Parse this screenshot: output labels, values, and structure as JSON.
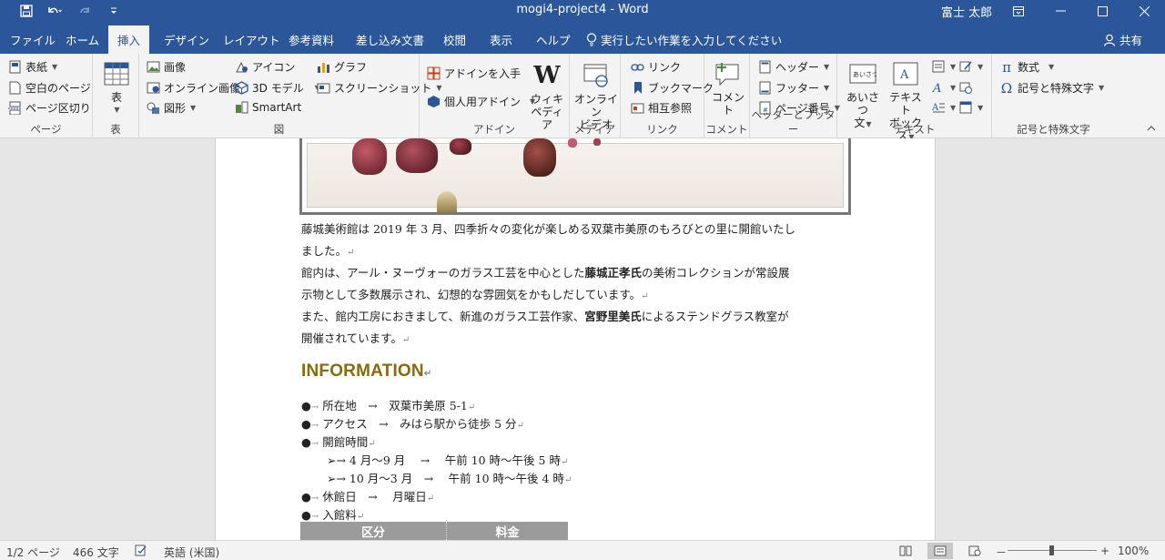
{
  "titlebar": {
    "document_title": "mogi4-project4  -  Word",
    "user_name": "富士 太郎"
  },
  "tabs": [
    {
      "label": "ファイル"
    },
    {
      "label": "ホーム"
    },
    {
      "label": "挿入"
    },
    {
      "label": "デザイン"
    },
    {
      "label": "レイアウト"
    },
    {
      "label": "参考資料"
    },
    {
      "label": "差し込み文書"
    },
    {
      "label": "校閲"
    },
    {
      "label": "表示"
    },
    {
      "label": "ヘルプ"
    }
  ],
  "tell_me": "実行したい作業を入力してください",
  "share": "共有",
  "ribbon": {
    "page_group": {
      "label": "ページ",
      "cover": "表紙",
      "blank": "空白のページ",
      "break": "ページ区切り"
    },
    "table_group": {
      "label": "表",
      "table": "表"
    },
    "illust_group": {
      "label": "図",
      "picture": "画像",
      "online_picture": "オンライン画像",
      "shapes": "図形",
      "icons": "アイコン",
      "models3d": "3D モデル",
      "smartart": "SmartArt",
      "chart": "グラフ",
      "screenshot": "スクリーンショット"
    },
    "addin_group": {
      "label": "アドイン",
      "get": "アドインを入手",
      "my": "個人用アドイン",
      "wiki1": "ウィキ",
      "wiki2": "ペディア"
    },
    "media_group": {
      "label": "メディア",
      "video1": "オンライン",
      "video2": "ビデオ"
    },
    "link_group": {
      "label": "リンク",
      "link": "リンク",
      "bookmark": "ブックマーク",
      "crossref": "相互参照"
    },
    "comment_group": {
      "label": "コメント",
      "comment": "コメント"
    },
    "hf_group": {
      "label": "ヘッダーとフッター",
      "header": "ヘッダー",
      "footer": "フッター",
      "pagenum": "ページ番号"
    },
    "text_group": {
      "label": "テキスト",
      "greeting1": "あいさつ",
      "greeting2": "文",
      "textbox1": "テキスト",
      "textbox2": "ボックス",
      "greeting_icon": "あいさつ"
    },
    "symbol_group": {
      "label": "記号と特殊文字",
      "equation": "数式",
      "symbol": "記号と特殊文字"
    }
  },
  "document": {
    "para1_a": "藤城美術館は 2019 年 3 月、四季折々の変化が楽しめる双葉市美原のもろびとの里に開館いたし",
    "para1_b": "ました。",
    "para2_a1": "館内は、アール・ヌーヴォーのガラス工芸を中心とした",
    "para2_a_bold": "藤城正孝氏",
    "para2_a2": "の美術コレクションが常設展",
    "para2_b": "示物として多数展示され、幻想的な雰囲気をかもしだしています。",
    "para3_a1": "また、館内工房におきまして、新進のガラス工芸作家、",
    "para3_a_bold": "宮野里美氏",
    "para3_a2": "によるステンドグラス教室が",
    "para3_b": "開催されています。",
    "heading": "INFORMATION",
    "items": [
      {
        "text": "所在地　→　双葉市美原 5-1"
      },
      {
        "text": "アクセス　→　みはら駅から徒歩 5 分"
      },
      {
        "text": "開館時間"
      },
      {
        "text": "→ 4 月～9 月　 →　 午前 10 時～午後 5 時"
      },
      {
        "text": "→ 10 月～3 月　→　 午前 10 時～午後 4 時"
      },
      {
        "text": "休館日　→　 月曜日"
      },
      {
        "text": "入館料"
      }
    ],
    "table_headers": [
      "区分",
      "料金"
    ]
  },
  "statusbar": {
    "page": "1/2 ページ",
    "words": "466 文字",
    "language": "英語 (米国)",
    "zoom": "100%",
    "zoom_minus": "－",
    "zoom_plus": "+"
  },
  "colors": {
    "brand": "#2b579a",
    "heading": "#8a6a0c"
  }
}
